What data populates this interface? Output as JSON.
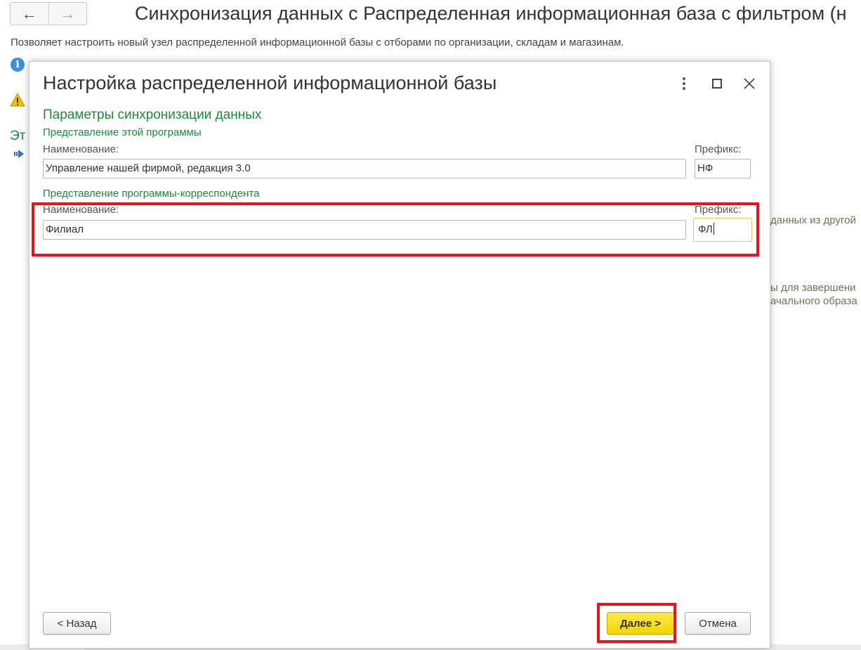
{
  "background": {
    "nav": {
      "back_icon": "←",
      "forward_icon": "→"
    },
    "title": "Синхронизация данных с Распределенная информационная база с фильтром (н",
    "description": "Позволяет настроить новый узел распределенной информационной базы с отборами по организации, складам и магазинам.",
    "green_text": "Эт",
    "side_text_1": "данных из другой",
    "side_text_2": "ы для завершени",
    "side_text_3": "ачального образа"
  },
  "dialog": {
    "title": "Настройка распределенной информационной базы",
    "controls": {
      "more": "more-vertical-icon",
      "maximize": "maximize-icon",
      "close": "close-icon"
    },
    "section_title": "Параметры синхронизации данных",
    "this_program": {
      "group_title": "Представление этой программы",
      "name_label": "Наименование:",
      "name_value": "Управление нашей фирмой, редакция 3.0",
      "prefix_label": "Префикс:",
      "prefix_value": "НФ"
    },
    "correspondent": {
      "group_title": "Представление программы-корреспондента",
      "name_label": "Наименование:",
      "name_value": "Филиал",
      "prefix_label": "Префикс:",
      "prefix_value": "ФЛ"
    },
    "buttons": {
      "back": "< Назад",
      "next": "Далее >",
      "cancel": "Отмена"
    }
  },
  "colors": {
    "section_green": "#1c8a3c",
    "highlight_red": "#e8141c",
    "primary_yellow": "#f3d500",
    "focus_border": "#f2c94c"
  }
}
